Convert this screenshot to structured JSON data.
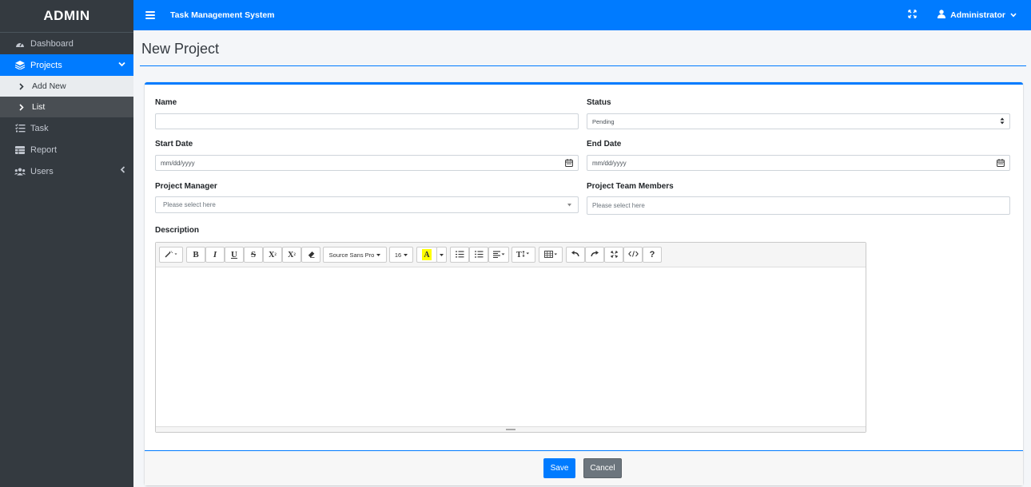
{
  "sidebar": {
    "brand": "ADMIN",
    "items": {
      "dashboard": "Dashboard",
      "projects": "Projects",
      "add_new": "Add New",
      "list": "List",
      "task": "Task",
      "report": "Report",
      "users": "Users"
    }
  },
  "topbar": {
    "title": "Task Management System",
    "user": "Administrator"
  },
  "page": {
    "title": "New Project"
  },
  "form": {
    "name_label": "Name",
    "status_label": "Status",
    "status_value": "Pending",
    "start_label": "Start Date",
    "start_placeholder": "mm/dd/yyyy",
    "end_label": "End Date",
    "end_placeholder": "mm/dd/yyyy",
    "manager_label": "Project Manager",
    "manager_placeholder": "Please select here",
    "members_label": "Project Team Members",
    "members_placeholder": "Please select here",
    "description_label": "Description"
  },
  "editor": {
    "font_name": "Source Sans Pro",
    "font_size": "16"
  },
  "buttons": {
    "save": "Save",
    "cancel": "Cancel"
  },
  "colors": {
    "primary": "#007bff",
    "sidebar": "#343a40",
    "secondary": "#6c757d"
  }
}
